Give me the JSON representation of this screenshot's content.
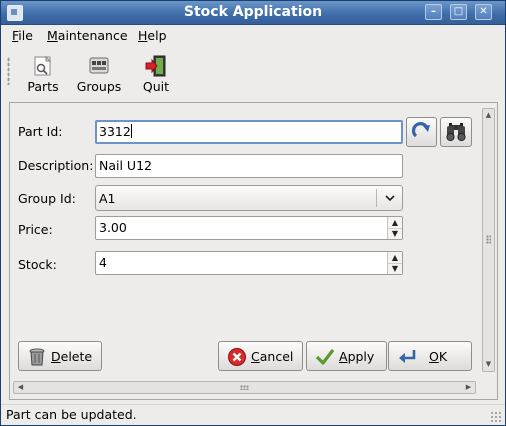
{
  "window": {
    "title": "Stock Application",
    "controls": {
      "minimize": "–",
      "maximize": "□",
      "close": "✕"
    }
  },
  "menu": {
    "file": {
      "mnemonic": "F",
      "rest": "ile"
    },
    "maintenance": {
      "mnemonic": "M",
      "rest": "aintenance"
    },
    "help": {
      "mnemonic": "H",
      "rest": "elp"
    }
  },
  "toolbar": {
    "parts": "Parts",
    "groups": "Groups",
    "quit": "Quit"
  },
  "form": {
    "part_id_label": "Part Id:",
    "part_id_value": "3312",
    "description_label": "Description:",
    "description_value": "Nail U12",
    "group_id_label": "Group Id:",
    "group_id_value": "A1",
    "price_label": "Price:",
    "price_value": "3.00",
    "stock_label": "Stock:",
    "stock_value": "4"
  },
  "buttons": {
    "delete": {
      "mnemonic": "D",
      "rest": "elete"
    },
    "cancel": {
      "mnemonic": "C",
      "rest": "ancel"
    },
    "apply": {
      "mnemonic": "A",
      "rest": "pply"
    },
    "ok": {
      "mnemonic": "O",
      "rest": "K"
    }
  },
  "status": {
    "message": "Part can be updated."
  },
  "colors": {
    "titlebar": "#3f6eaa",
    "focus_border": "#6e93c5",
    "window_bg": "#edeceb"
  }
}
